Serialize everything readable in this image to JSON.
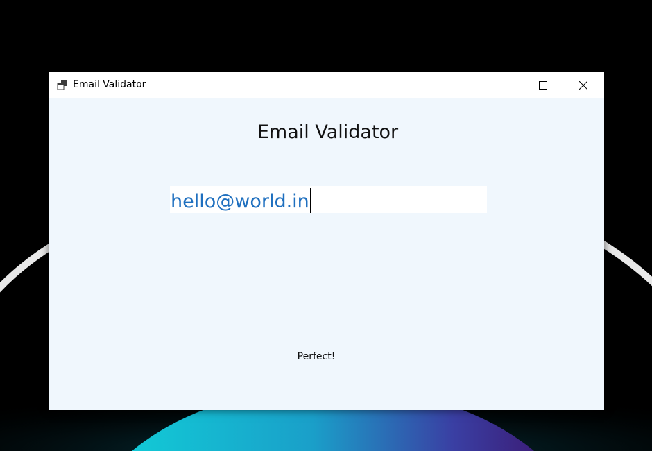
{
  "window": {
    "title": "Email Validator",
    "icon": "app-window-icon",
    "controls": [
      "minimize-icon",
      "maximize-icon",
      "close-icon"
    ]
  },
  "main": {
    "heading": "Email Validator",
    "email_input": {
      "value": "hello@world.in",
      "text_color": "#1e6fbf"
    },
    "status_text": "Perfect!"
  },
  "colors": {
    "window_background": "#f0f7fd",
    "titlebar_background": "#ffffff",
    "desktop_background": "#000000"
  }
}
